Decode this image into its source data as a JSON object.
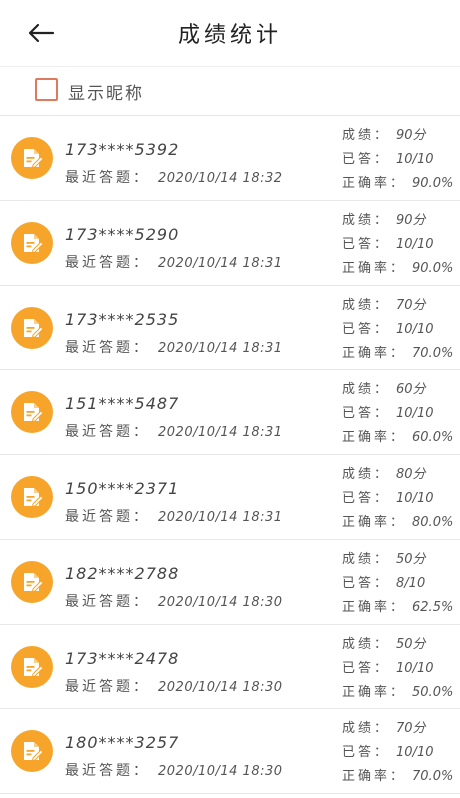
{
  "header": {
    "title": "成绩统计",
    "back_icon": "arrow-left-icon"
  },
  "toggle": {
    "label": "显示昵称",
    "checked": false
  },
  "labels": {
    "recent": "最近答题：",
    "score": "成绩：",
    "answered": "已答：",
    "accuracy": "正确率："
  },
  "records": [
    {
      "phone": "173****5392",
      "date": "2020/10/14 18:32",
      "score": "90分",
      "answered": "10/10",
      "accuracy": "90.0%"
    },
    {
      "phone": "173****5290",
      "date": "2020/10/14 18:31",
      "score": "90分",
      "answered": "10/10",
      "accuracy": "90.0%"
    },
    {
      "phone": "173****2535",
      "date": "2020/10/14 18:31",
      "score": "70分",
      "answered": "10/10",
      "accuracy": "70.0%"
    },
    {
      "phone": "151****5487",
      "date": "2020/10/14 18:31",
      "score": "60分",
      "answered": "10/10",
      "accuracy": "60.0%"
    },
    {
      "phone": "150****2371",
      "date": "2020/10/14 18:31",
      "score": "80分",
      "answered": "10/10",
      "accuracy": "80.0%"
    },
    {
      "phone": "182****2788",
      "date": "2020/10/14 18:30",
      "score": "50分",
      "answered": "8/10",
      "accuracy": "62.5%"
    },
    {
      "phone": "173****2478",
      "date": "2020/10/14 18:30",
      "score": "50分",
      "answered": "10/10",
      "accuracy": "50.0%"
    },
    {
      "phone": "180****3257",
      "date": "2020/10/14 18:30",
      "score": "70分",
      "answered": "10/10",
      "accuracy": "70.0%"
    }
  ],
  "colors": {
    "accent": "#f6a52a",
    "checkbox_border": "#e07a5f"
  }
}
